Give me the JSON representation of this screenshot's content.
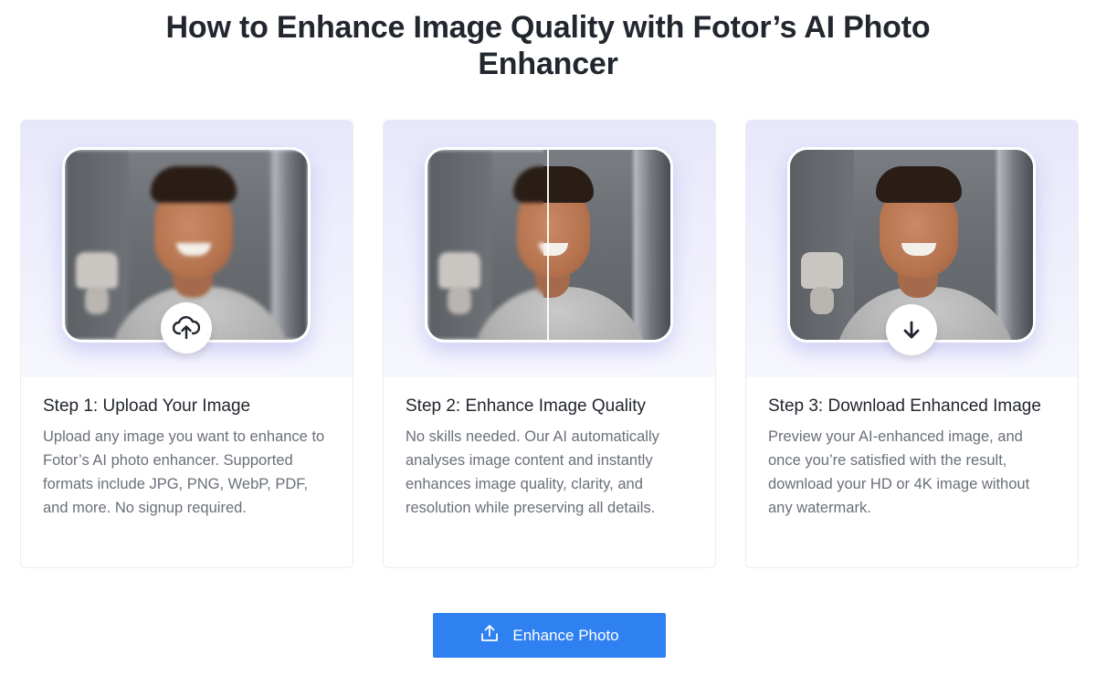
{
  "heading": "How to Enhance Image Quality with Fotor’s AI Photo Enhancer",
  "steps": [
    {
      "title": "Step 1: Upload Your Image",
      "description": "Upload any image you want to enhance to Fotor’s AI photo enhancer. Supported formats include JPG, PNG, WebP, PDF, and more. No signup required.",
      "icon": "cloud-upload-icon"
    },
    {
      "title": "Step 2: Enhance Image Quality",
      "description": "No skills needed. Our AI automatically analyses image content and instantly enhances image quality, clarity, and resolution while preserving all details.",
      "icon": "before-after-compare"
    },
    {
      "title": "Step 3: Download Enhanced Image",
      "description": "Preview your AI-enhanced image, and once you’re satisfied with the result, download your HD or 4K image without any watermark.",
      "icon": "download-arrow-icon"
    }
  ],
  "cta": {
    "label": "Enhance Photo",
    "icon": "upload-icon",
    "color": "#2f80f0"
  },
  "colors": {
    "heading": "#22262e",
    "body_text": "#6a6f78",
    "hero_bg": "#ececfb"
  }
}
